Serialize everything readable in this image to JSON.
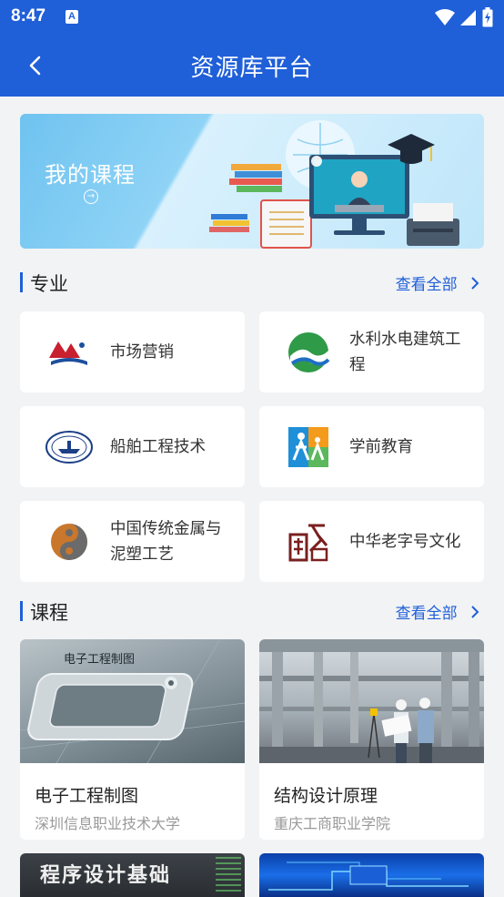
{
  "status_bar": {
    "time": "8:47",
    "notif_icon": "a-icon",
    "icons": [
      "wifi-icon",
      "signal-icon",
      "battery-charging-icon"
    ]
  },
  "header": {
    "title": "资源库平台",
    "back_icon": "back-arrow-icon"
  },
  "banner": {
    "title": "我的课程",
    "icon": "arrow-right-circle-icon"
  },
  "majors": {
    "title": "专业",
    "view_all": "查看全部",
    "items": [
      {
        "label": "市场营销"
      },
      {
        "label": "水利水电建筑工程"
      },
      {
        "label": "船舶工程技术"
      },
      {
        "label": "学前教育"
      },
      {
        "label": "中国传统金属与泥塑工艺"
      },
      {
        "label": "中华老字号文化"
      }
    ]
  },
  "courses": {
    "title": "课程",
    "view_all": "查看全部",
    "items": [
      {
        "name": "电子工程制图",
        "school": "深圳信息职业技术大学",
        "thumb_text": "电子工程制图"
      },
      {
        "name": "结构设计原理",
        "school": "重庆工商职业学院"
      },
      {
        "thumb_text": "程序设计基础"
      },
      {}
    ]
  },
  "colors": {
    "primary": "#1f5fd8",
    "background": "#f2f3f5"
  }
}
